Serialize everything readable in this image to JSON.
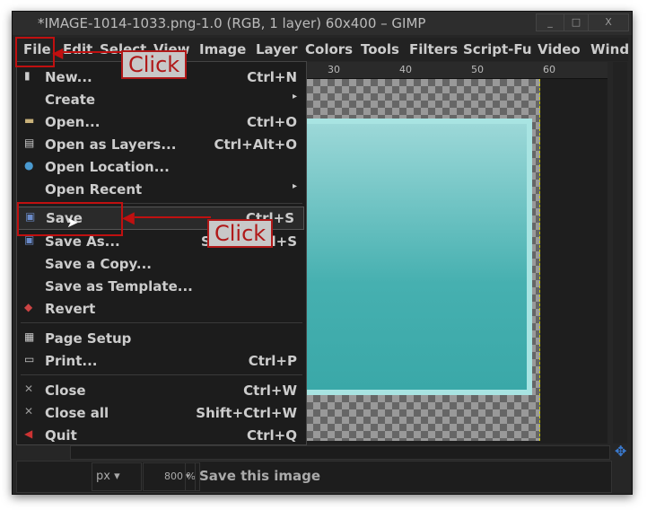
{
  "window": {
    "title": "*IMAGE-1014-1033.png-1.0 (RGB, 1 layer) 60x400 – GIMP",
    "minimize": "_",
    "maximize": "□",
    "close": "X"
  },
  "menubar": [
    "File",
    "Edit",
    "Select",
    "View",
    "Image",
    "Layer",
    "Colors",
    "Tools",
    "Filters",
    "Script-Fu",
    "Video",
    "Wind"
  ],
  "ruler": [
    "30",
    "40",
    "50",
    "60"
  ],
  "file_menu": [
    {
      "label": "New...",
      "shortcut": "Ctrl+N",
      "icon": "new-file-icon"
    },
    {
      "label": "Create",
      "shortcut": "▸",
      "icon": ""
    },
    {
      "label": "Open...",
      "shortcut": "Ctrl+O",
      "icon": "folder-icon"
    },
    {
      "label": "Open as Layers...",
      "shortcut": "Ctrl+Alt+O",
      "icon": "layers-icon"
    },
    {
      "label": "Open Location...",
      "shortcut": "",
      "icon": "globe-icon"
    },
    {
      "label": "Open Recent",
      "shortcut": "▸",
      "icon": ""
    },
    {
      "label": "Save",
      "shortcut": "Ctrl+S",
      "icon": "save-icon"
    },
    {
      "label": "Save As...",
      "shortcut": "Shift+Ctrl+S",
      "icon": "save-as-icon"
    },
    {
      "label": "Save a Copy...",
      "shortcut": "",
      "icon": ""
    },
    {
      "label": "Save as Template...",
      "shortcut": "",
      "icon": ""
    },
    {
      "label": "Revert",
      "shortcut": "",
      "icon": "revert-icon"
    },
    {
      "label": "Page Setup",
      "shortcut": "",
      "icon": "page-setup-icon"
    },
    {
      "label": "Print...",
      "shortcut": "Ctrl+P",
      "icon": "printer-icon"
    },
    {
      "label": "Close",
      "shortcut": "Ctrl+W",
      "icon": "close-icon"
    },
    {
      "label": "Close all",
      "shortcut": "Shift+Ctrl+W",
      "icon": "close-icon"
    },
    {
      "label": "Quit",
      "shortcut": "Ctrl+Q",
      "icon": "quit-icon"
    }
  ],
  "status": {
    "unit": "px",
    "zoom": "800 %",
    "message": "Save this image"
  },
  "annotations": {
    "callout1": "Click",
    "callout2": "Click"
  },
  "colors": {
    "accent": "#c01010",
    "teal": "#46b0b0"
  }
}
